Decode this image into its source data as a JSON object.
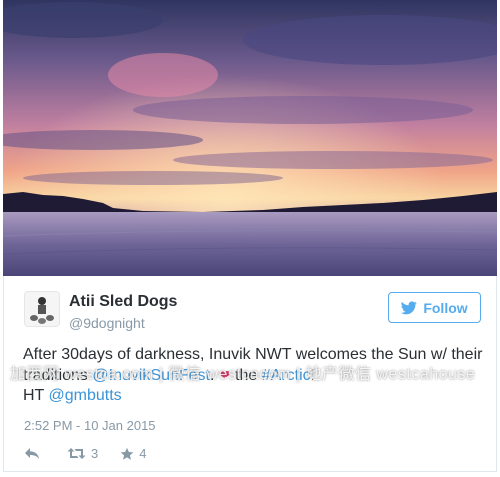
{
  "tweet": {
    "display_name": "Atii Sled Dogs",
    "handle": "@9dognight",
    "follow_label": "Follow",
    "text_part1": "After 30days of darkness, Inuvik NWT welcomes the Sun w/ their traditions ",
    "mention1": "@InuvikSunFest",
    "text_part2": ". ",
    "text_part3": " the ",
    "hashtag": "#Arctic",
    "text_part4": "!",
    "ht_label": "HT ",
    "mention2": "@gmbutts",
    "timestamp": "2:52 PM - 10 Jan 2015",
    "retweet_count": "3",
    "favorite_count": "4"
  },
  "watermark": {
    "text": "加西网 westca.com | 微信 westcacom | 地产微信 westcahouse"
  },
  "icons": {
    "follow": "twitter-bird-icon",
    "reply": "reply-icon",
    "retweet": "retweet-icon",
    "favorite": "star-icon",
    "heart": "heart-icon"
  },
  "colors": {
    "accent": "#55acee",
    "link": "#3b94d9",
    "text": "#292f33",
    "muted": "#8899a6",
    "heart": "#e0245e"
  }
}
